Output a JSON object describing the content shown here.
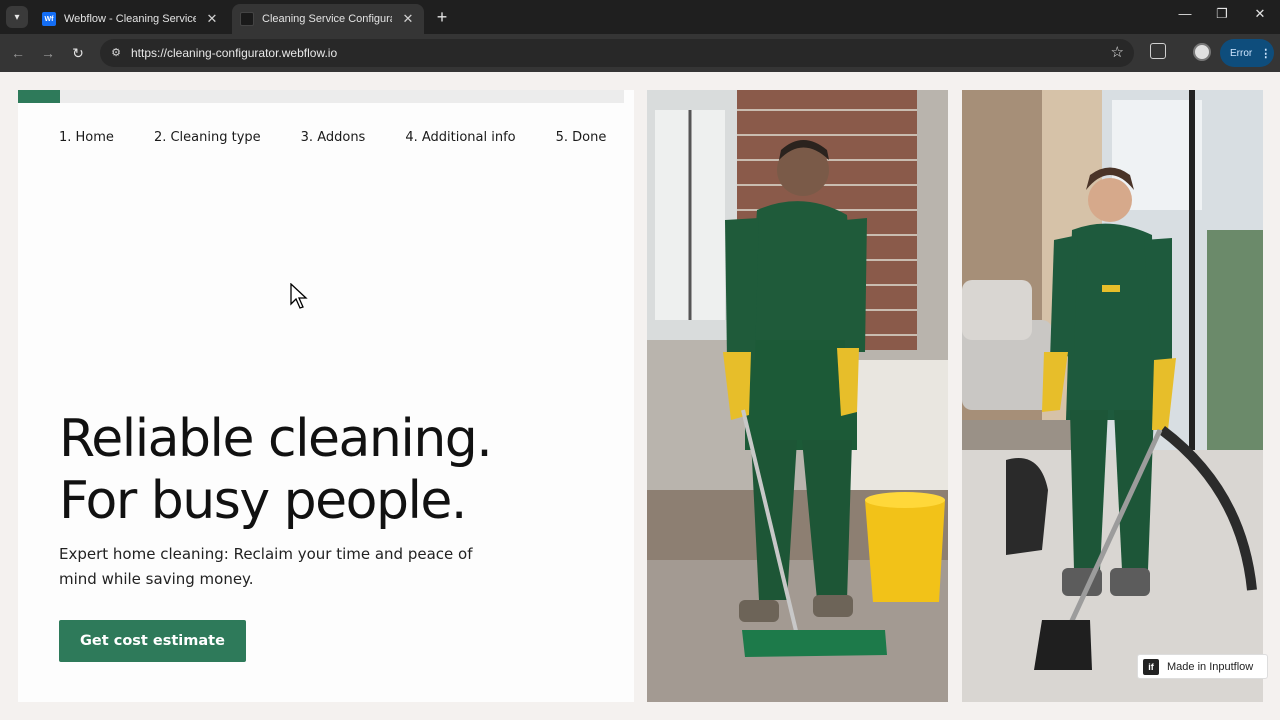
{
  "browser": {
    "tabs": [
      {
        "title": "Webflow - Cleaning Service Configurator",
        "favicon": "webflow-icon",
        "active": false
      },
      {
        "title": "Cleaning Service Configurator",
        "favicon": "blank-page-icon",
        "active": true
      }
    ],
    "url": "https://cleaning-configurator.webflow.io",
    "error_label": "Error",
    "window_controls": {
      "minimize": "—",
      "restore": "❐",
      "close": "✕"
    }
  },
  "page": {
    "progress": 0.07,
    "steps": [
      "1. Home",
      "2. Cleaning type",
      "3. Addons",
      "4. Additional info",
      "5. Done"
    ],
    "headline_line1": "Reliable cleaning.",
    "headline_line2": "For busy people.",
    "subtext": "Expert home cleaning: Reclaim your time and peace of mind while saving money.",
    "cta_label": "Get cost estimate",
    "badge_text": "Made in Inputflow",
    "badge_logo": "if"
  },
  "colors": {
    "accent": "#2e7a5a",
    "page_bg": "#f4f1ef",
    "chrome_dark": "#1f1f1f",
    "error_pill": "#0e4d7c"
  }
}
